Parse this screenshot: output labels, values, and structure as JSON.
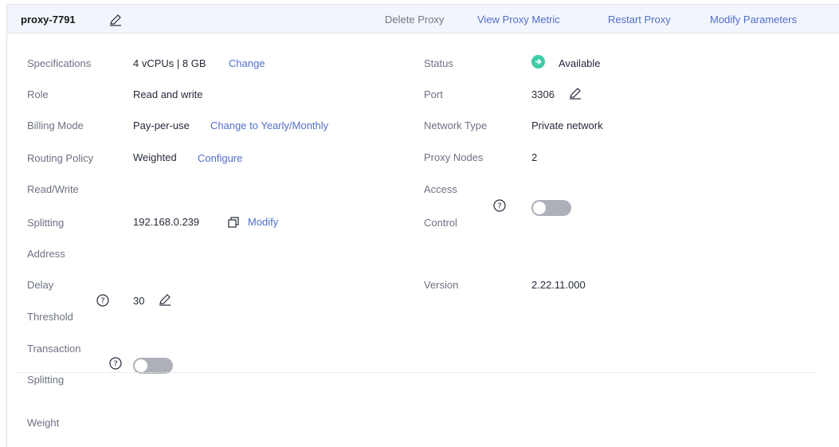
{
  "header": {
    "proxy_name": "proxy-7791",
    "actions": {
      "delete": "Delete Proxy",
      "view_metric": "View Proxy Metric",
      "restart": "Restart Proxy",
      "modify_params": "Modify Parameters"
    }
  },
  "left": {
    "specifications": {
      "label": "Specifications",
      "value": "4 vCPUs | 8 GB",
      "link": "Change"
    },
    "role": {
      "label": "Role",
      "value": "Read and write"
    },
    "billing_mode": {
      "label": "Billing Mode",
      "value": "Pay-per-use",
      "link": "Change to Yearly/Monthly"
    },
    "routing_policy": {
      "label": "Routing Policy",
      "value": "Weighted",
      "link": "Configure"
    },
    "rw_splitting_address": {
      "label_line1": "Read/Write",
      "label_line2": "Splitting",
      "label_line3": "Address",
      "value": "192.168.0.239",
      "link": "Modify"
    },
    "delay_threshold": {
      "label_line1": "Delay",
      "label_line2": "Threshold",
      "value": "30"
    },
    "transaction_splitting": {
      "label_line1": "Transaction",
      "label_line2": "Splitting",
      "enabled": false
    },
    "weight": {
      "label": "Weight"
    }
  },
  "right": {
    "status": {
      "label": "Status",
      "value": "Available",
      "color": "#3dcca6"
    },
    "port": {
      "label": "Port",
      "value": "3306"
    },
    "network_type": {
      "label": "Network Type",
      "value": "Private network"
    },
    "proxy_nodes": {
      "label": "Proxy Nodes",
      "value": "2"
    },
    "access_control": {
      "label_line1": "Access",
      "label_line2": "Control",
      "enabled": false
    },
    "version": {
      "label": "Version",
      "value": "2.22.11.000"
    }
  },
  "colors": {
    "link": "#526ecc",
    "label": "#6d7282",
    "toggle_off": "#adb0b8",
    "header_bg": "#f2f5fc"
  },
  "icons": [
    "edit-icon",
    "help-icon",
    "copy-icon",
    "status-available-icon"
  ]
}
